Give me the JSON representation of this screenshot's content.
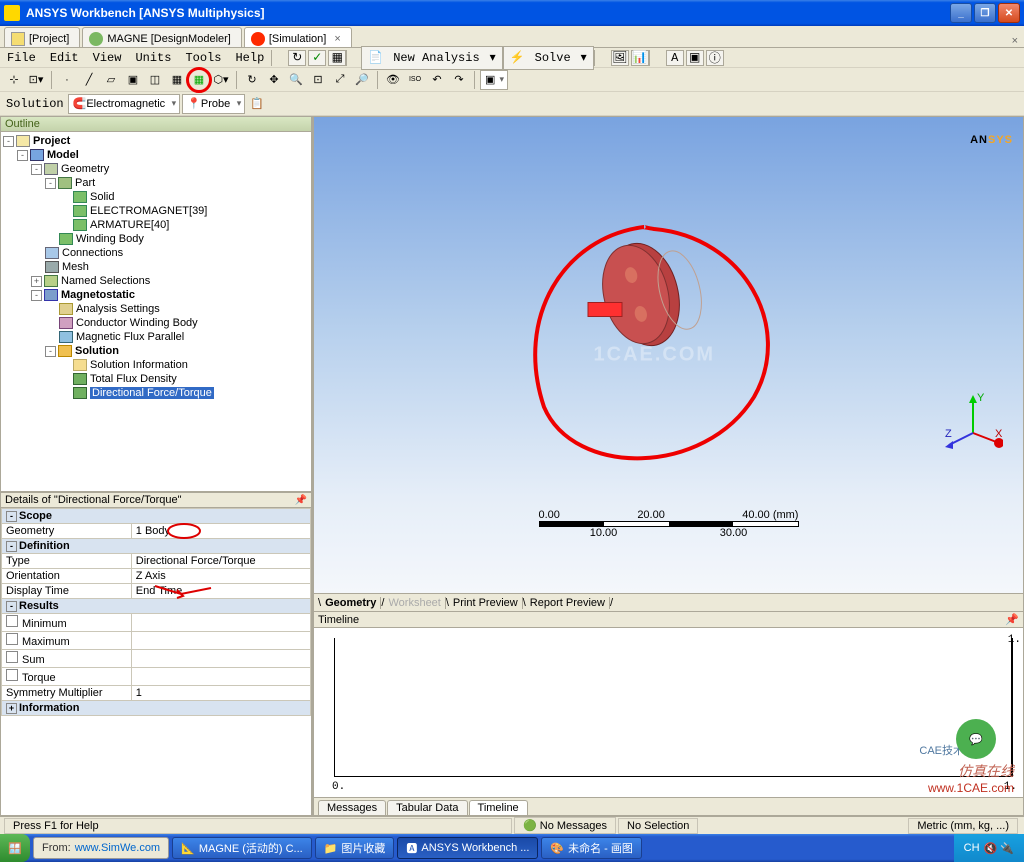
{
  "titlebar": {
    "title": "ANSYS Workbench [ANSYS Multiphysics]"
  },
  "doctabs": {
    "project": "[Project]",
    "magne": "MAGNE [DesignModeler]",
    "simulation": "[Simulation]",
    "right_x": "×"
  },
  "menubar": {
    "file": "File",
    "edit": "Edit",
    "view": "View",
    "units": "Units",
    "tools": "Tools",
    "help": "Help",
    "new_analysis": "New Analysis",
    "solve": "Solve"
  },
  "contextbar": {
    "solution": "Solution",
    "electromagnetic": "Electromagnetic",
    "probe": "Probe"
  },
  "outline": {
    "header": "Outline",
    "project": "Project",
    "model": "Model",
    "geometry": "Geometry",
    "part": "Part",
    "solid": "Solid",
    "electromagnet": "ELECTROMAGNET[39]",
    "armature": "ARMATURE[40]",
    "winding_body": "Winding Body",
    "connections": "Connections",
    "mesh": "Mesh",
    "named_selections": "Named Selections",
    "magnetostatic": "Magnetostatic",
    "analysis_settings": "Analysis Settings",
    "conductor_winding_body": "Conductor Winding Body",
    "magnetic_flux_parallel": "Magnetic Flux Parallel",
    "solution": "Solution",
    "solution_information": "Solution Information",
    "total_flux_density": "Total Flux Density",
    "directional_force_torque": "Directional Force/Torque"
  },
  "details": {
    "header": "Details of \"Directional Force/Torque\"",
    "scope": "Scope",
    "geometry_k": "Geometry",
    "geometry_v": "1 Body",
    "definition": "Definition",
    "type_k": "Type",
    "type_v": "Directional Force/Torque",
    "orientation_k": "Orientation",
    "orientation_v": "Z Axis",
    "display_time_k": "Display Time",
    "display_time_v": "End Time",
    "results": "Results",
    "minimum": "Minimum",
    "maximum": "Maximum",
    "sum": "Sum",
    "torque": "Torque",
    "symmult_k": "Symmetry Multiplier",
    "symmult_v": "1",
    "information": "Information"
  },
  "viewport": {
    "ansys_an": "AN",
    "ansys_sys": "SYS",
    "watermark": "1CAE.COM",
    "scale": {
      "t0": "0.00",
      "t1": "20.00",
      "t2": "40.00 (mm)",
      "b0": "10.00",
      "b1": "30.00"
    },
    "triad": {
      "x": "X",
      "y": "Y",
      "z": "Z"
    }
  },
  "viewtabs": {
    "geometry": "Geometry",
    "worksheet": "Worksheet",
    "print_preview": "Print Preview",
    "report_preview": "Report Preview"
  },
  "timeline": {
    "header": "Timeline",
    "x0": "0.",
    "x1": "1.",
    "y1": "1."
  },
  "bottom_tabs": {
    "messages": "Messages",
    "tabular": "Tabular Data",
    "timeline": "Timeline"
  },
  "statusbar": {
    "hint": "Press F1 for Help",
    "no_messages": "No Messages",
    "no_selection": "No Selection",
    "units": "Metric (mm, kg, ...)"
  },
  "taskbar": {
    "from": "From:",
    "simwe": "www.SimWe.com",
    "t1": "MAGNE (活动的) C...",
    "t2": "图片收藏",
    "t3": "ANSYS Workbench ...",
    "t4": "未命名 - 画图",
    "tray": "CH"
  },
  "watermarks": {
    "cae": "CAE技术联盟",
    "fz": "仿真在线",
    "url": "www.1CAE.com"
  }
}
